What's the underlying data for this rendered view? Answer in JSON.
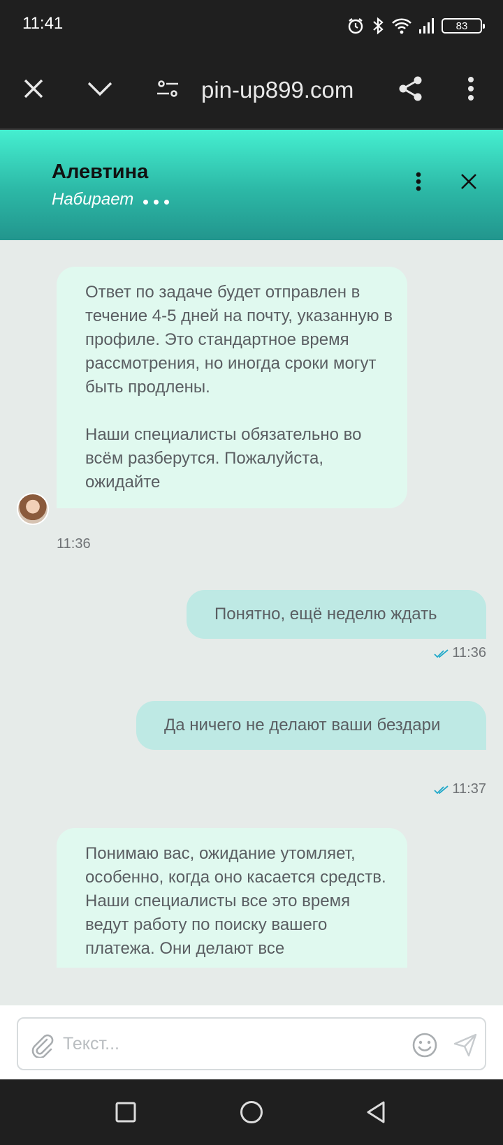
{
  "status_bar": {
    "time": "11:41",
    "battery": "83",
    "icons": [
      "alarm-icon",
      "bluetooth-icon",
      "wifi-icon",
      "signal-icon",
      "battery-icon"
    ]
  },
  "browser": {
    "url": "pin-up899.com",
    "icons": [
      "close-icon",
      "chevron-down-icon",
      "page-settings-icon",
      "share-icon",
      "more-vertical-icon"
    ]
  },
  "chat_header": {
    "agent_name": "Алевтина",
    "agent_status": "Набирает"
  },
  "messages": [
    {
      "direction": "incoming",
      "text": "Ответ по задаче будет отправлен в течение 4-5 дней на почту, указанную в профиле. Это стандартное время рассмотрения, но иногда сроки могут быть продлены.\n\nНаши специалисты обязательно во всём разберутся. Пожалуйста, ожидайте",
      "time": "11:36"
    },
    {
      "direction": "outgoing",
      "text": "Понятно, ещё неделю ждать",
      "time": "11:36"
    },
    {
      "direction": "outgoing",
      "text": "Да ничего не делают ваши бездари",
      "time": "11:37"
    },
    {
      "direction": "incoming",
      "text": "Понимаю вас, ожидание утомляет, особенно, когда оно касается средств. Наши специалисты все это время ведут работу по поиску вашего платежа. Они делают все"
    }
  ],
  "input": {
    "placeholder": "Текст..."
  },
  "colors": {
    "header_gradient_top": "#45efd0",
    "header_gradient_bottom": "#22958d",
    "incoming_bubble": "#e0f9ef",
    "outgoing_bubble": "#bee9e4",
    "chat_background": "#e6ebe9",
    "read_check": "#1fa8c9"
  }
}
